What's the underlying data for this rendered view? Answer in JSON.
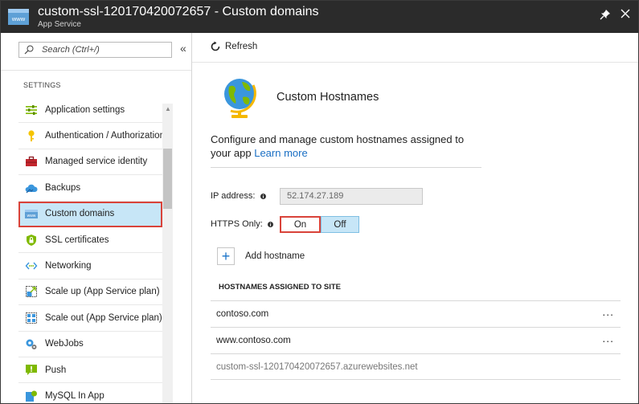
{
  "window": {
    "title": "custom-ssl-120170420072657 - Custom domains",
    "subtitle": "App Service"
  },
  "search": {
    "placeholder": "Search (Ctrl+/)"
  },
  "nav": {
    "collapse_glyph": "«",
    "section_label": "SETTINGS",
    "items": [
      {
        "label": "Application settings",
        "icon": "settings-sliders-icon"
      },
      {
        "label": "Authentication / Authorization",
        "icon": "key-icon"
      },
      {
        "label": "Managed service identity",
        "icon": "toolbox-icon"
      },
      {
        "label": "Backups",
        "icon": "cloud-backup-icon"
      },
      {
        "label": "Custom domains",
        "icon": "www-icon",
        "selected": true
      },
      {
        "label": "SSL certificates",
        "icon": "shield-lock-icon"
      },
      {
        "label": "Networking",
        "icon": "networking-icon"
      },
      {
        "label": "Scale up (App Service plan)",
        "icon": "scale-up-icon"
      },
      {
        "label": "Scale out (App Service plan)",
        "icon": "scale-out-icon"
      },
      {
        "label": "WebJobs",
        "icon": "webjobs-gear-icon"
      },
      {
        "label": "Push",
        "icon": "push-icon"
      },
      {
        "label": "MySQL In App",
        "icon": "mysql-icon"
      }
    ]
  },
  "toolbar": {
    "refresh_label": "Refresh"
  },
  "main": {
    "hero_title": "Custom Hostnames",
    "description": "Configure and manage custom hostnames assigned to your app",
    "learn_more": "Learn more",
    "ip_label": "IP address:",
    "ip_value": "52.174.27.189",
    "https_label": "HTTPS Only:",
    "https_on": "On",
    "https_off": "Off",
    "https_selected": "Off",
    "add_hostname": "Add hostname",
    "hostnames_header": "HOSTNAMES ASSIGNED TO SITE",
    "hostnames": [
      {
        "name": "contoso.com",
        "more": "..."
      },
      {
        "name": "www.contoso.com",
        "more": "..."
      },
      {
        "name": "custom-ssl-120170420072657.azurewebsites.net",
        "more": ""
      }
    ]
  },
  "colors": {
    "header_bg": "#2b2b2b",
    "selected_bg": "#c7e6f7",
    "highlight_border": "#d9433a",
    "link": "#1a6fc4"
  }
}
